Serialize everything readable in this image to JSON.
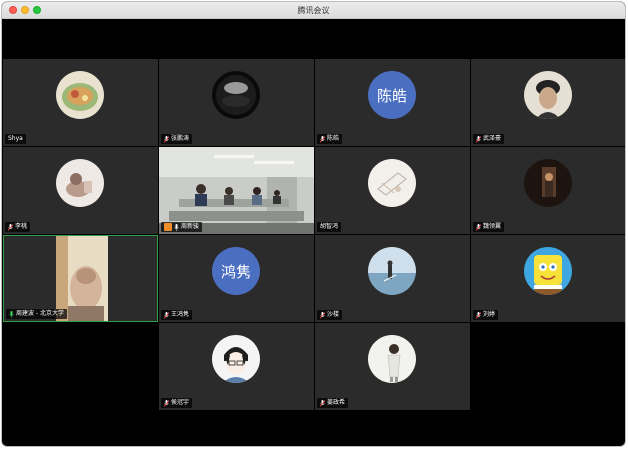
{
  "window": {
    "title": "腾讯会议"
  },
  "participants": [
    {
      "name": "Shya",
      "avatar_type": "image",
      "avatar_desc": "food-bowl"
    },
    {
      "name": "张鹏涛",
      "avatar_type": "image",
      "avatar_desc": "dark-sphere"
    },
    {
      "name": "陈皓",
      "avatar_type": "text",
      "avatar_text": "陈皓"
    },
    {
      "name": "武泽豪",
      "avatar_type": "image",
      "avatar_desc": "portrait"
    },
    {
      "name": "李桃",
      "avatar_type": "image",
      "avatar_desc": "figurine"
    },
    {
      "name": "周新骏",
      "avatar_type": "video",
      "host": true
    },
    {
      "name": "胡智鸿",
      "avatar_type": "image",
      "avatar_desc": "sketch"
    },
    {
      "name": "魏领翼",
      "avatar_type": "image",
      "avatar_desc": "dark-room"
    },
    {
      "name": "周建波 - 北京大学",
      "avatar_type": "video",
      "speaking": true
    },
    {
      "name": "王鸿隽",
      "avatar_type": "text",
      "avatar_text": "鸿隽"
    },
    {
      "name": "沙楼",
      "avatar_type": "image",
      "avatar_desc": "sea-sky"
    },
    {
      "name": "刘婷",
      "avatar_type": "image",
      "avatar_desc": "cartoon-sponge"
    },
    {
      "name": "侯冠宇",
      "avatar_type": "image",
      "avatar_desc": "anime-boy"
    },
    {
      "name": "姜政希",
      "avatar_type": "image",
      "avatar_desc": "girl-figure"
    }
  ],
  "colors": {
    "tile_bg": "#2b2b2b",
    "text_avatar": "#4a6fc1",
    "speaking_border": "#2ea043",
    "host_badge": "#f08c2a"
  }
}
